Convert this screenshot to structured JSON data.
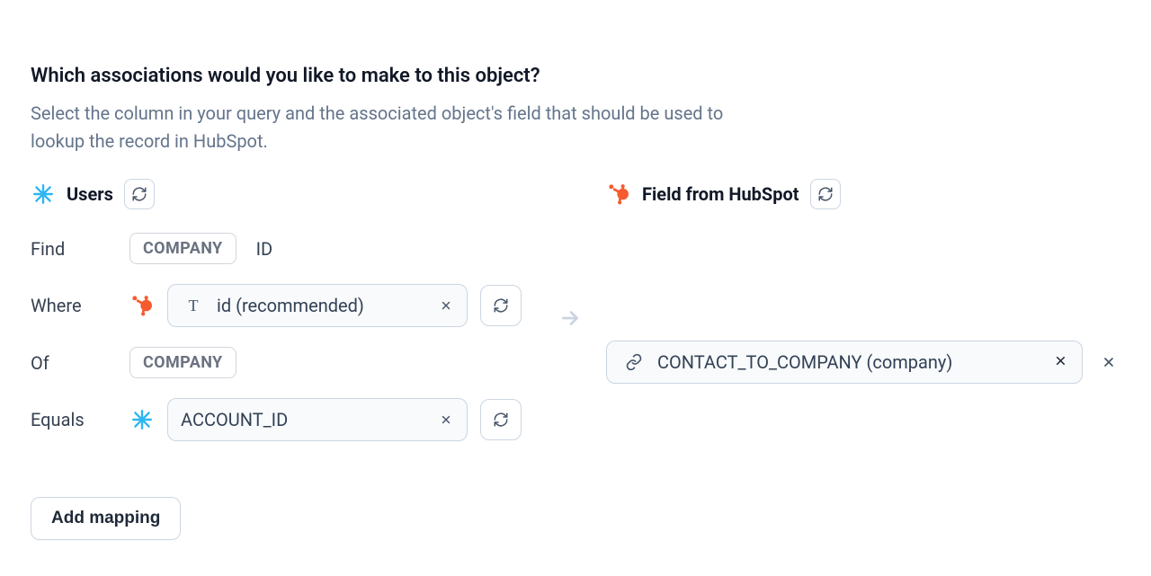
{
  "heading": "Which associations would you like to make to this object?",
  "subheading": "Select the column in your query and the associated object's field that should be used to lookup the record in HubSpot.",
  "left": {
    "title": "Users"
  },
  "right": {
    "title": "Field from HubSpot"
  },
  "rows": {
    "find": {
      "label": "Find",
      "chip": "COMPANY",
      "suffix": "ID"
    },
    "where": {
      "label": "Where",
      "value": "id (recommended)"
    },
    "of": {
      "label": "Of",
      "chip": "COMPANY"
    },
    "equals": {
      "label": "Equals",
      "value": "ACCOUNT_ID"
    }
  },
  "association": {
    "value": "CONTACT_TO_COMPANY (company)"
  },
  "addMapping": "Add mapping"
}
